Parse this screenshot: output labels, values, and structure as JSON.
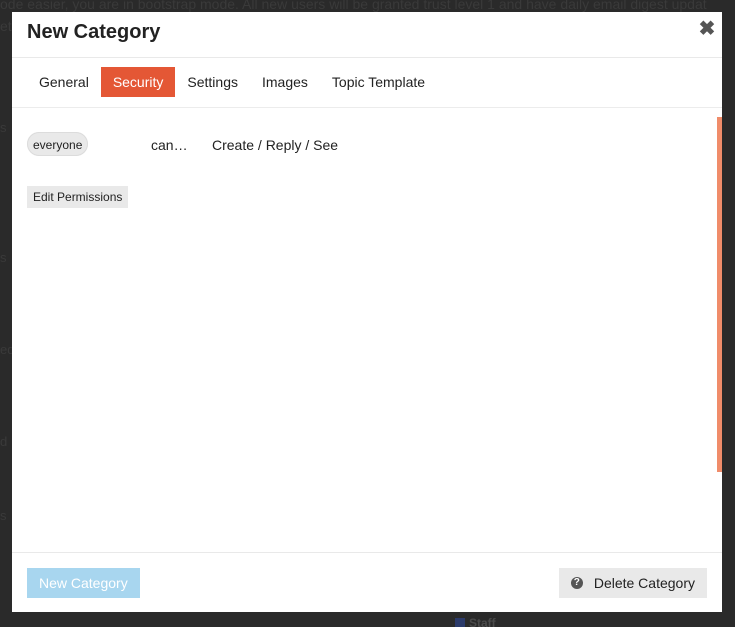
{
  "background": {
    "text_line1": "ode easier, you are in bootstrap mode. All new users will be granted trust level 1 and have daily email digest updat",
    "text_line2": "et",
    "left_fragments": [
      "s",
      "s",
      "s",
      "ed",
      "d",
      "s"
    ],
    "staff_label": "Staff"
  },
  "modal": {
    "title": "New Category",
    "close_symbol": "✖"
  },
  "tabs": [
    {
      "label": "General",
      "active": false
    },
    {
      "label": "Security",
      "active": true
    },
    {
      "label": "Settings",
      "active": false
    },
    {
      "label": "Images",
      "active": false
    },
    {
      "label": "Topic Template",
      "active": false
    }
  ],
  "security": {
    "group": "everyone",
    "can_label": "can…",
    "permissions": "Create / Reply / See",
    "edit_button": "Edit Permissions"
  },
  "footer": {
    "new_category_button": "New Category",
    "delete_category_button": "Delete Category",
    "help_icon": "question-circle-icon"
  },
  "colors": {
    "accent": "#e45735",
    "primary_disabled": "#a8d6ef",
    "scrollbar": "#f08c6a"
  }
}
